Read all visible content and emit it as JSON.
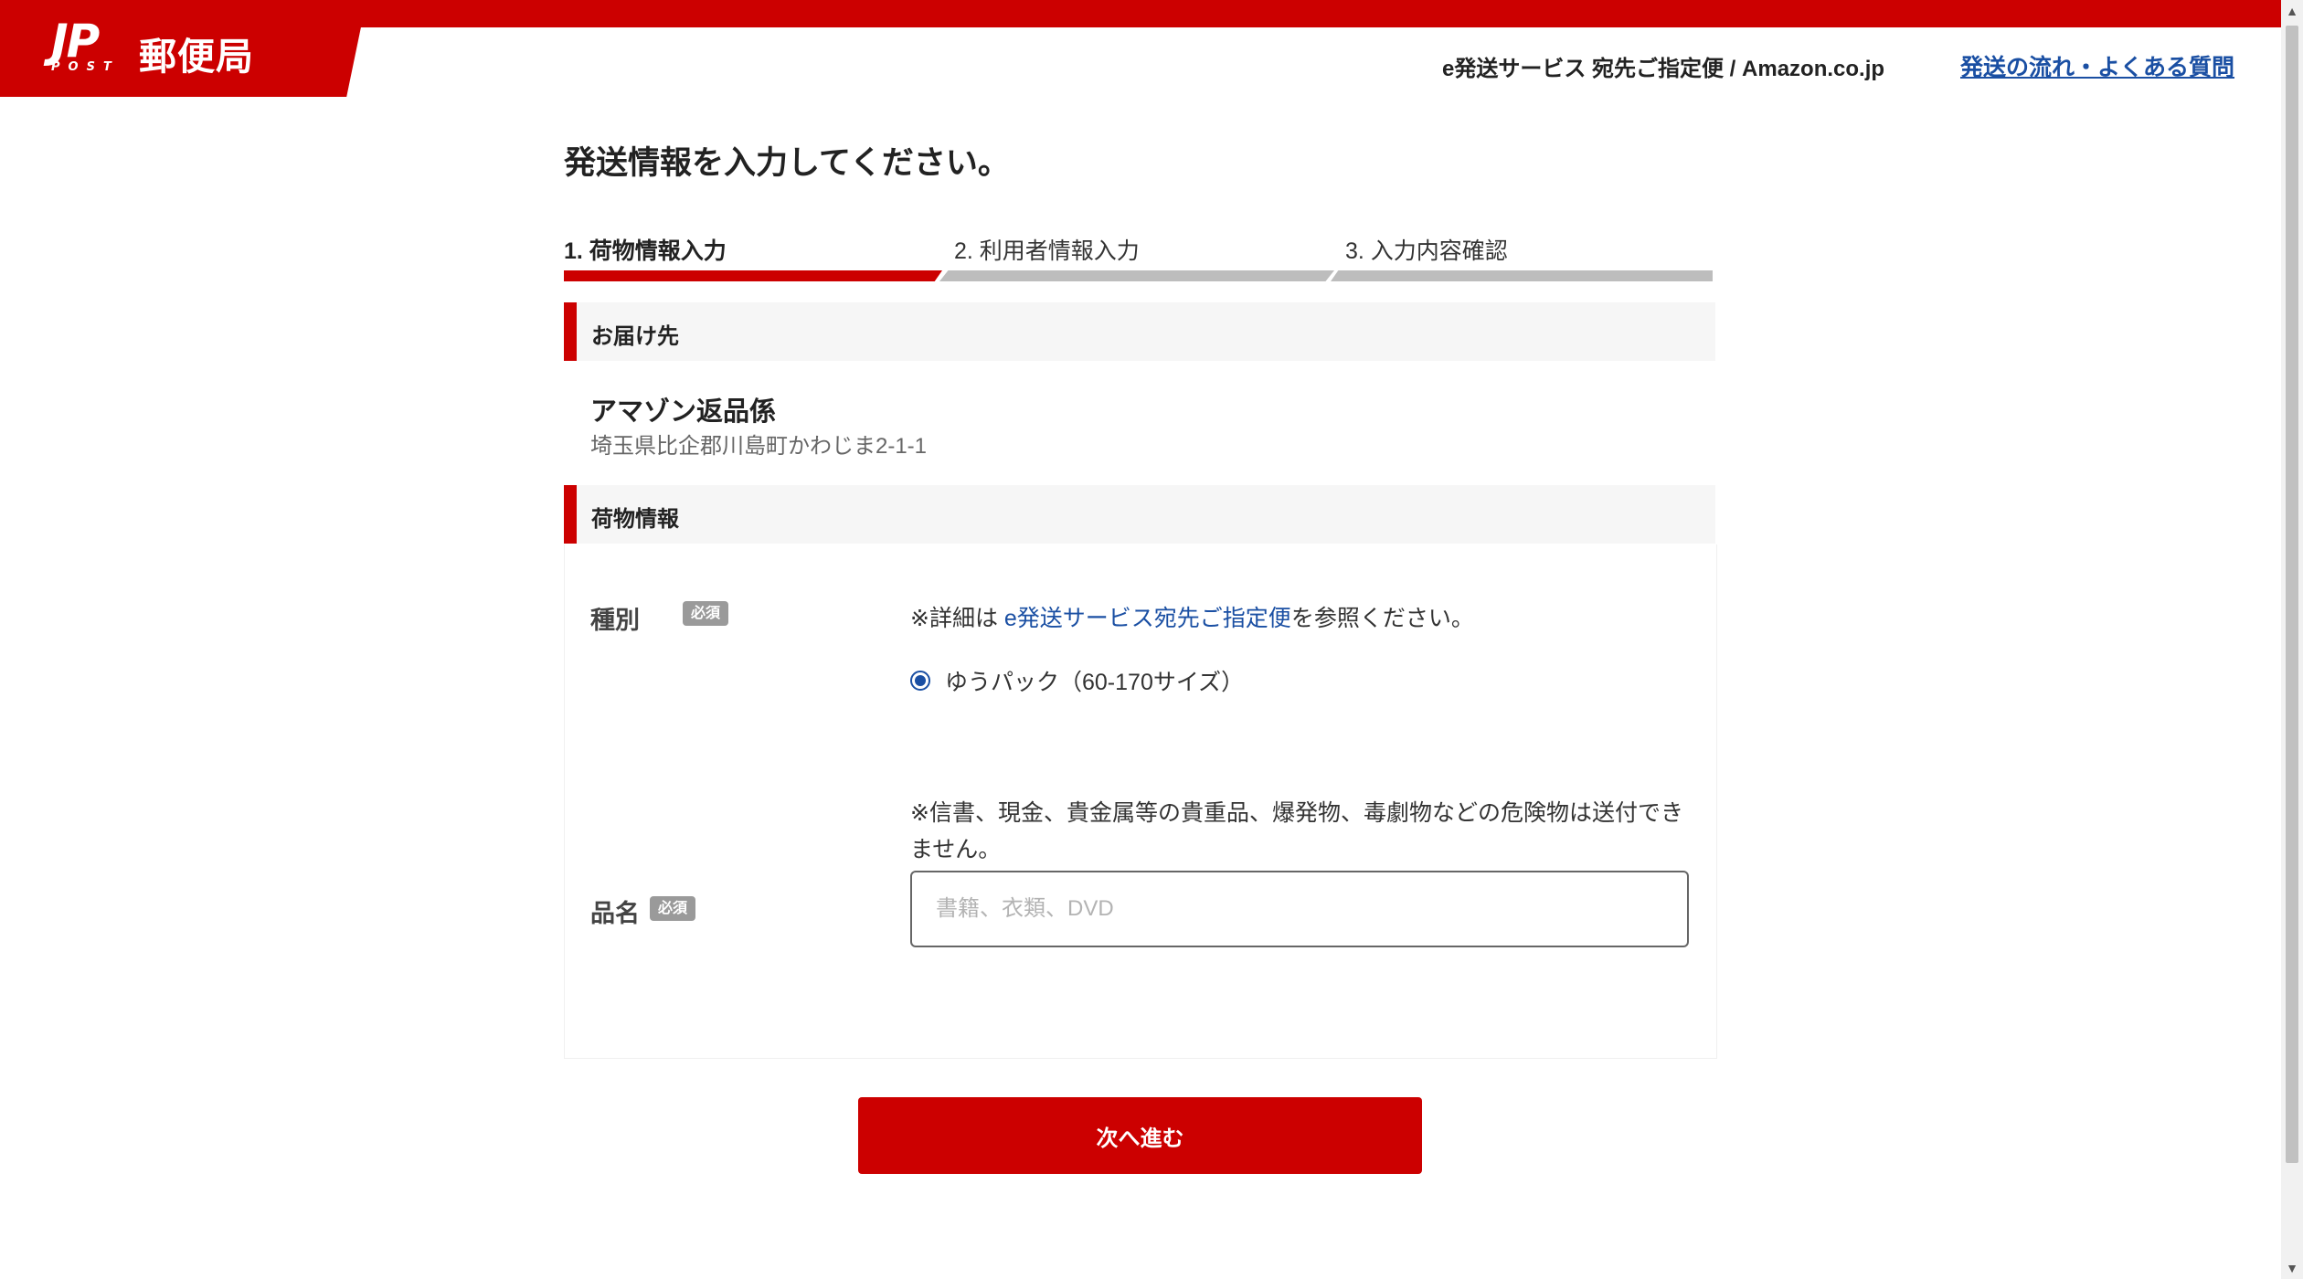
{
  "header": {
    "logo_mark": "JP",
    "logo_sub": "POST",
    "logo_text": "郵便局",
    "service_title": "e発送サービス 宛先ご指定便 / Amazon.co.jp",
    "help_link": "発送の流れ・よくある質問"
  },
  "page": {
    "title": "発送情報を入力してください。"
  },
  "steps": [
    {
      "label": "1. 荷物情報入力",
      "active": true
    },
    {
      "label": "2. 利用者情報入力",
      "active": false
    },
    {
      "label": "3. 入力内容確認",
      "active": false
    }
  ],
  "destination": {
    "section_title": "お届け先",
    "name": "アマゾン返品係",
    "address": "埼玉県比企郡川島町かわじま2-1-1"
  },
  "package": {
    "section_title": "荷物情報",
    "type_label": "種別",
    "required_badge": "必須",
    "note_prefix": "※詳細は ",
    "note_link": "e発送サービス宛先ご指定便",
    "note_suffix": "を参照ください。",
    "option_label": "ゆうパック（60-170サイズ）",
    "option_selected": true,
    "warning": "※信書、現金、貴金属等の貴重品、爆発物、毒劇物などの危険物は送付できません。",
    "item_label": "品名",
    "item_placeholder": "書籍、衣類、DVD",
    "item_value": ""
  },
  "actions": {
    "next_label": "次へ進む"
  },
  "colors": {
    "brand_red": "#cc0000",
    "link_blue": "#1a4fa3",
    "inactive_step": "#bdbdbd"
  }
}
